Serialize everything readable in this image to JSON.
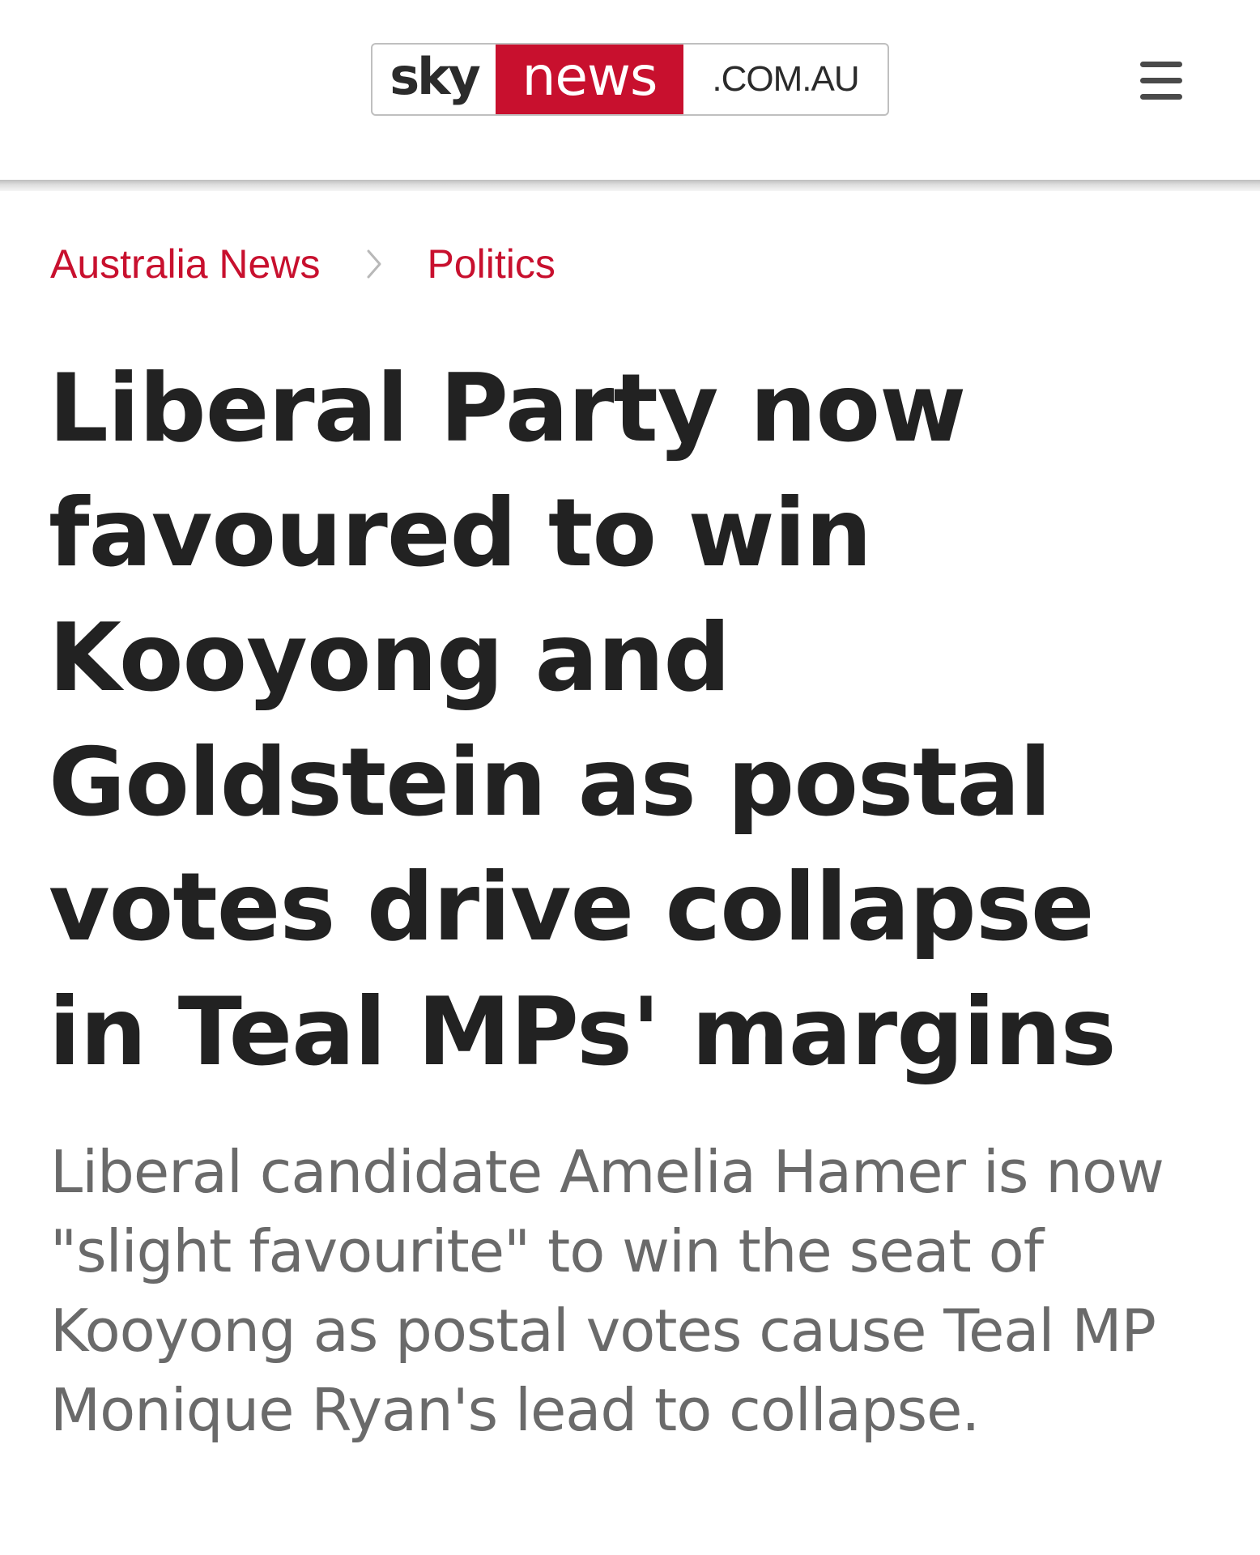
{
  "header": {
    "logo": {
      "sky": "sky",
      "news": "news",
      "domain": ".COM.AU"
    },
    "menu_icon": "hamburger-menu-icon"
  },
  "breadcrumb": {
    "items": [
      {
        "label": "Australia News"
      },
      {
        "label": "Politics"
      }
    ],
    "separator_icon": "chevron-right-icon"
  },
  "article": {
    "headline": "Liberal Party now favoured to win Kooyong and Goldstein as postal votes drive collapse in Teal MPs' margins",
    "standfirst": "Liberal candidate Amelia Hamer is now \"slight favourite\" to win the seat of Kooyong as postal votes cause Teal MP Monique Ryan's lead to collapse."
  },
  "colors": {
    "brand_red": "#c8102e",
    "headline_text": "#222222",
    "standfirst_text": "#6a6a6a"
  }
}
